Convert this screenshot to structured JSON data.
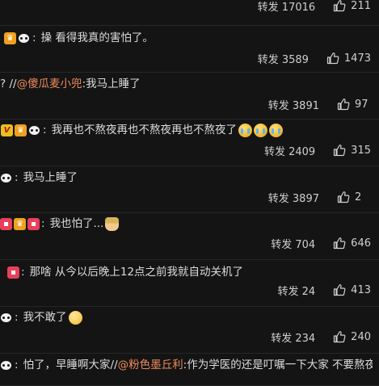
{
  "comments": [
    {
      "text_parts": [],
      "repost": "转发 17016",
      "likes": "211",
      "badges": []
    },
    {
      "badges": [
        "crown",
        "panda"
      ],
      "text_parts": [
        {
          "t": "操 看得我真的害怕了。"
        }
      ],
      "repost": "转发 3589",
      "likes": "1473"
    },
    {
      "badges": [],
      "lead": "? //",
      "text_parts": [
        {
          "t": "@傻瓜麦小兜",
          "mention": true
        },
        {
          "t": ":我马上睡了"
        }
      ],
      "repost": "转发 3891",
      "likes": "97"
    },
    {
      "badges": [
        "v",
        "crown",
        "panda"
      ],
      "text_parts": [
        {
          "t": "我再也不熬夜再也不熬夜再也不熬夜了"
        }
      ],
      "emojis": [
        "cry",
        "cry",
        "cry"
      ],
      "repost": "转发 2409",
      "likes": "315"
    },
    {
      "badges": [
        "panda"
      ],
      "text_parts": [
        {
          "t": "我马上睡了"
        }
      ],
      "repost": "转发 3897",
      "likes": "2"
    },
    {
      "badges": [
        "pink",
        "crown",
        "pink"
      ],
      "text_parts": [
        {
          "t": "我也怕了..."
        }
      ],
      "emojis": [
        "worker"
      ],
      "repost": "转发 704",
      "likes": "646"
    },
    {
      "badges": [
        "pink"
      ],
      "text_parts": [
        {
          "t": "那啥 从今以后晚上12点之前我就自动关机了"
        }
      ],
      "repost": "转发 24",
      "likes": "413"
    },
    {
      "badges": [
        "panda"
      ],
      "text_parts": [
        {
          "t": "我不敢了"
        }
      ],
      "emojis": [
        "shy"
      ],
      "repost": "转发 234",
      "likes": "240"
    },
    {
      "badges": [
        "panda"
      ],
      "text_parts": [
        {
          "t": "怕了，早睡啊大家//"
        },
        {
          "t": "@粉色墨丘利",
          "mention": true
        },
        {
          "t": ":作为学医的还是叮嘱一下大家 不要熬夜"
        }
      ],
      "repost": "",
      "likes": ""
    }
  ],
  "icons": {
    "like": "thumbs-up-icon",
    "panda": "panda-badge-icon"
  },
  "colors": {
    "background": "#141414",
    "mention": "#ee8a5c",
    "text": "#dcdcdc"
  }
}
